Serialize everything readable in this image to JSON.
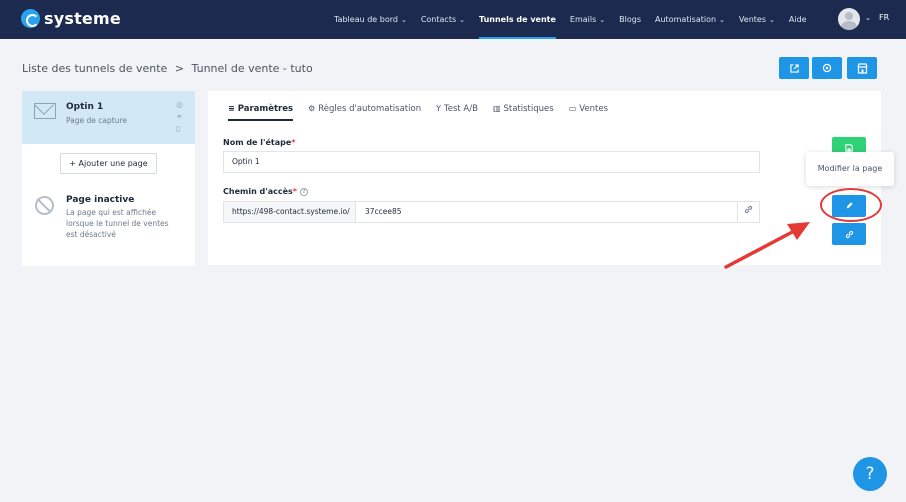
{
  "nav": {
    "logo": "systeme",
    "items": [
      {
        "label": "Tableau de bord",
        "dropdown": true,
        "active": false
      },
      {
        "label": "Contacts",
        "dropdown": true,
        "active": false
      },
      {
        "label": "Tunnels de vente",
        "dropdown": false,
        "active": true
      },
      {
        "label": "Emails",
        "dropdown": true,
        "active": false
      },
      {
        "label": "Blogs",
        "dropdown": false,
        "active": false
      },
      {
        "label": "Automatisation",
        "dropdown": true,
        "active": false
      },
      {
        "label": "Ventes",
        "dropdown": true,
        "active": false
      },
      {
        "label": "Aide",
        "dropdown": false,
        "active": false
      }
    ],
    "chevron": "⌄",
    "lang": "FR"
  },
  "breadcrumb": {
    "parent": "Liste des tunnels de vente",
    "separator": ">",
    "current": "Tunnel de vente - tuto"
  },
  "header_buttons": {
    "open_icon": "external-link-icon",
    "preview_icon": "eye-icon",
    "store_icon": "store-icon"
  },
  "left": {
    "step": {
      "title": "Optin 1",
      "subtitle": "Page de capture"
    },
    "add_page": "+  Ajouter une page",
    "inactive": {
      "title": "Page inactive",
      "description": "La page qui est affichée lorsque le tunnel de ventes est désactivé"
    }
  },
  "tabs": [
    {
      "label": "Paramètres",
      "icon": "≡",
      "active": true
    },
    {
      "label": "Règles d'automatisation",
      "icon": "⚙",
      "active": false
    },
    {
      "label": "Test A/B",
      "icon": "Y",
      "active": false
    },
    {
      "label": "Statistiques",
      "icon": "▥",
      "active": false
    },
    {
      "label": "Ventes",
      "icon": "▭",
      "active": false
    }
  ],
  "form": {
    "name_label": "Nom de l'étape",
    "name_value": "Optin 1",
    "path_label": "Chemin d'accès",
    "path_prefix": "https://498-contact.systeme.io/",
    "path_value": "37ccee85",
    "required_mark": "*",
    "help_mark": "?"
  },
  "tooltip": "Modifier la page",
  "help_fab": "?",
  "colors": {
    "nav_bg": "#1b2a4e",
    "accent": "#1f95e6",
    "save": "#2fd277",
    "annotation": "#e53935"
  }
}
